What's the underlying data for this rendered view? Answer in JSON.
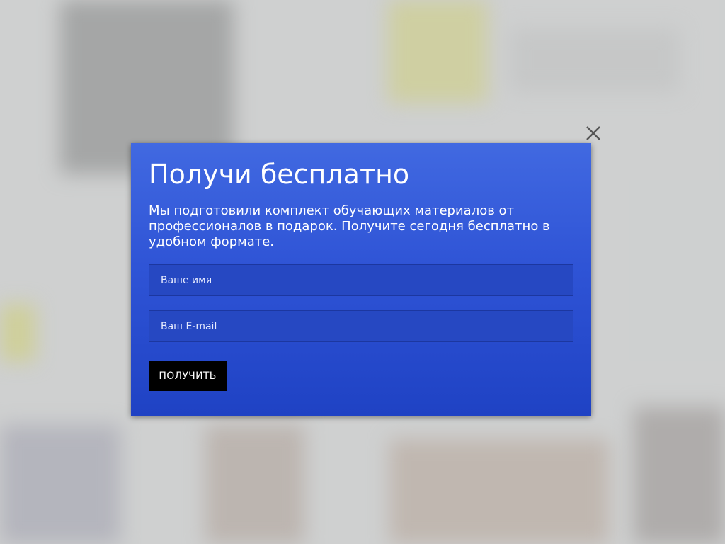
{
  "modal": {
    "title": "Получи бесплатно",
    "description": "Мы подготовили комплект обучающих материалов от профессионалов в подарок. Получите сегодня бесплатно в удобном формате.",
    "name_placeholder": "Ваше имя",
    "name_value": "",
    "email_placeholder": "Ваш E-mail",
    "email_value": "",
    "submit_label": "ПОЛУЧИТЬ",
    "close_icon": "close-icon"
  },
  "colors": {
    "modal_top": "#4169e1",
    "modal_bottom": "#1f42c4",
    "button": "#000000",
    "overlay": "#cfd1d1"
  }
}
